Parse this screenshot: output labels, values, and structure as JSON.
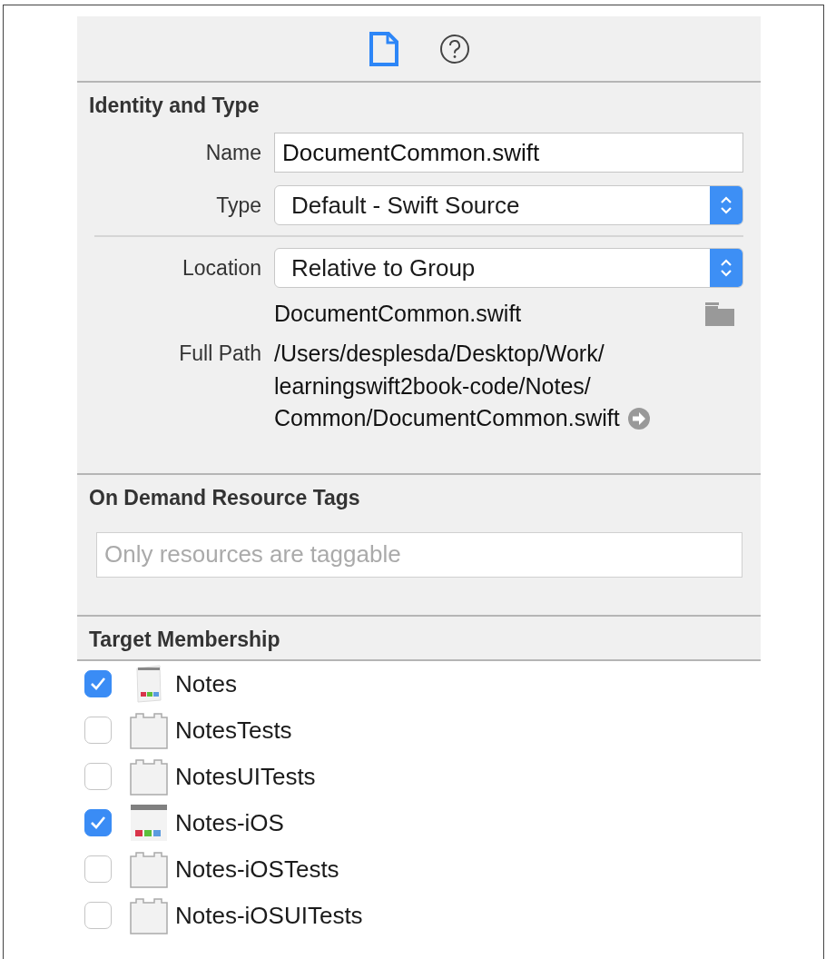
{
  "toolbar": {
    "tabs": [
      {
        "kind": "file",
        "selected": true
      },
      {
        "kind": "help",
        "selected": false
      }
    ]
  },
  "identity_and_type": {
    "title": "Identity and Type",
    "name": {
      "label": "Name",
      "value": "DocumentCommon.swift"
    },
    "type": {
      "label": "Type",
      "value": "Default - Swift Source"
    },
    "location": {
      "label": "Location",
      "value": "Relative to Group"
    },
    "file_name": "DocumentCommon.swift",
    "full_path": {
      "label": "Full Path",
      "lines": [
        "/Users/desplesda/Desktop/Work/",
        "learningswift2book-code/Notes/",
        "Common/DocumentCommon.swift"
      ]
    }
  },
  "on_demand_resource_tags": {
    "title": "On Demand Resource Tags",
    "placeholder": "Only resources are taggable"
  },
  "target_membership": {
    "title": "Target Membership",
    "targets": [
      {
        "name": "Notes",
        "checked": true,
        "kind": "app"
      },
      {
        "name": "NotesTests",
        "checked": false,
        "kind": "test"
      },
      {
        "name": "NotesUITests",
        "checked": false,
        "kind": "test"
      },
      {
        "name": "Notes-iOS",
        "checked": true,
        "kind": "ios-app"
      },
      {
        "name": "Notes-iOSTests",
        "checked": false,
        "kind": "test"
      },
      {
        "name": "Notes-iOSUITests",
        "checked": false,
        "kind": "test"
      }
    ]
  }
}
